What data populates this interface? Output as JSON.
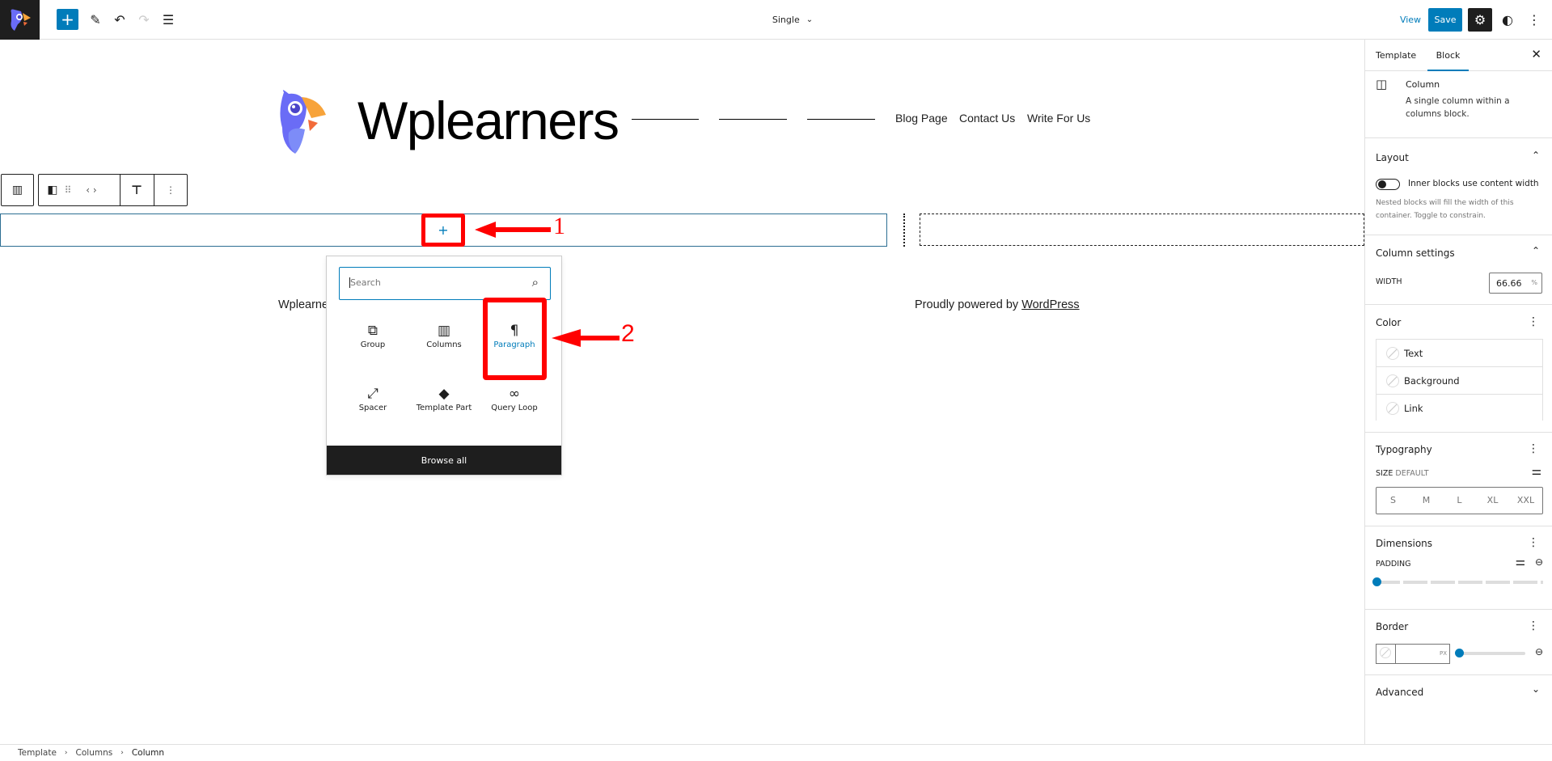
{
  "topbar": {
    "template_name": "Single",
    "view_label": "View",
    "save_label": "Save"
  },
  "site": {
    "title": "Wplearners",
    "nav": [
      "Blog Page",
      "Contact Us",
      "Write For Us"
    ],
    "footer_left": "Wplearners",
    "footer_right_prefix": "Proudly powered by ",
    "footer_right_link": "WordPress"
  },
  "inserter": {
    "search_placeholder": "Search",
    "blocks": [
      {
        "label": "Group",
        "icon": "group-icon"
      },
      {
        "label": "Columns",
        "icon": "columns-icon"
      },
      {
        "label": "Paragraph",
        "icon": "paragraph-icon"
      },
      {
        "label": "Spacer",
        "icon": "spacer-icon"
      },
      {
        "label": "Template Part",
        "icon": "template-part-icon"
      },
      {
        "label": "Query Loop",
        "icon": "query-loop-icon"
      }
    ],
    "browse_all": "Browse all"
  },
  "annotations": {
    "step1": "1",
    "step2": "2",
    "color": "#ff0000"
  },
  "sidebar": {
    "tabs": [
      "Template",
      "Block"
    ],
    "block": {
      "name": "Column",
      "description": "A single column within a columns block."
    },
    "layout": {
      "title": "Layout",
      "toggle_label": "Inner blocks use content width",
      "toggle_on": false,
      "help": "Nested blocks will fill the width of this container. Toggle to constrain."
    },
    "column_settings": {
      "title": "Column settings",
      "width_label": "WIDTH",
      "width_value": "66.66",
      "width_unit": "%"
    },
    "color": {
      "title": "Color",
      "items": [
        "Text",
        "Background",
        "Link"
      ]
    },
    "typography": {
      "title": "Typography",
      "size_label": "SIZE",
      "size_value": "DEFAULT",
      "sizes": [
        "S",
        "M",
        "L",
        "XL",
        "XXL"
      ]
    },
    "dimensions": {
      "title": "Dimensions",
      "padding_label": "PADDING",
      "padding_value": 0
    },
    "border": {
      "title": "Border",
      "unit": "PX",
      "value": 0
    },
    "advanced": {
      "title": "Advanced"
    }
  },
  "breadcrumb": [
    "Template",
    "Columns",
    "Column"
  ],
  "colors": {
    "accent": "#007cba",
    "dark": "#1e1e1e"
  }
}
